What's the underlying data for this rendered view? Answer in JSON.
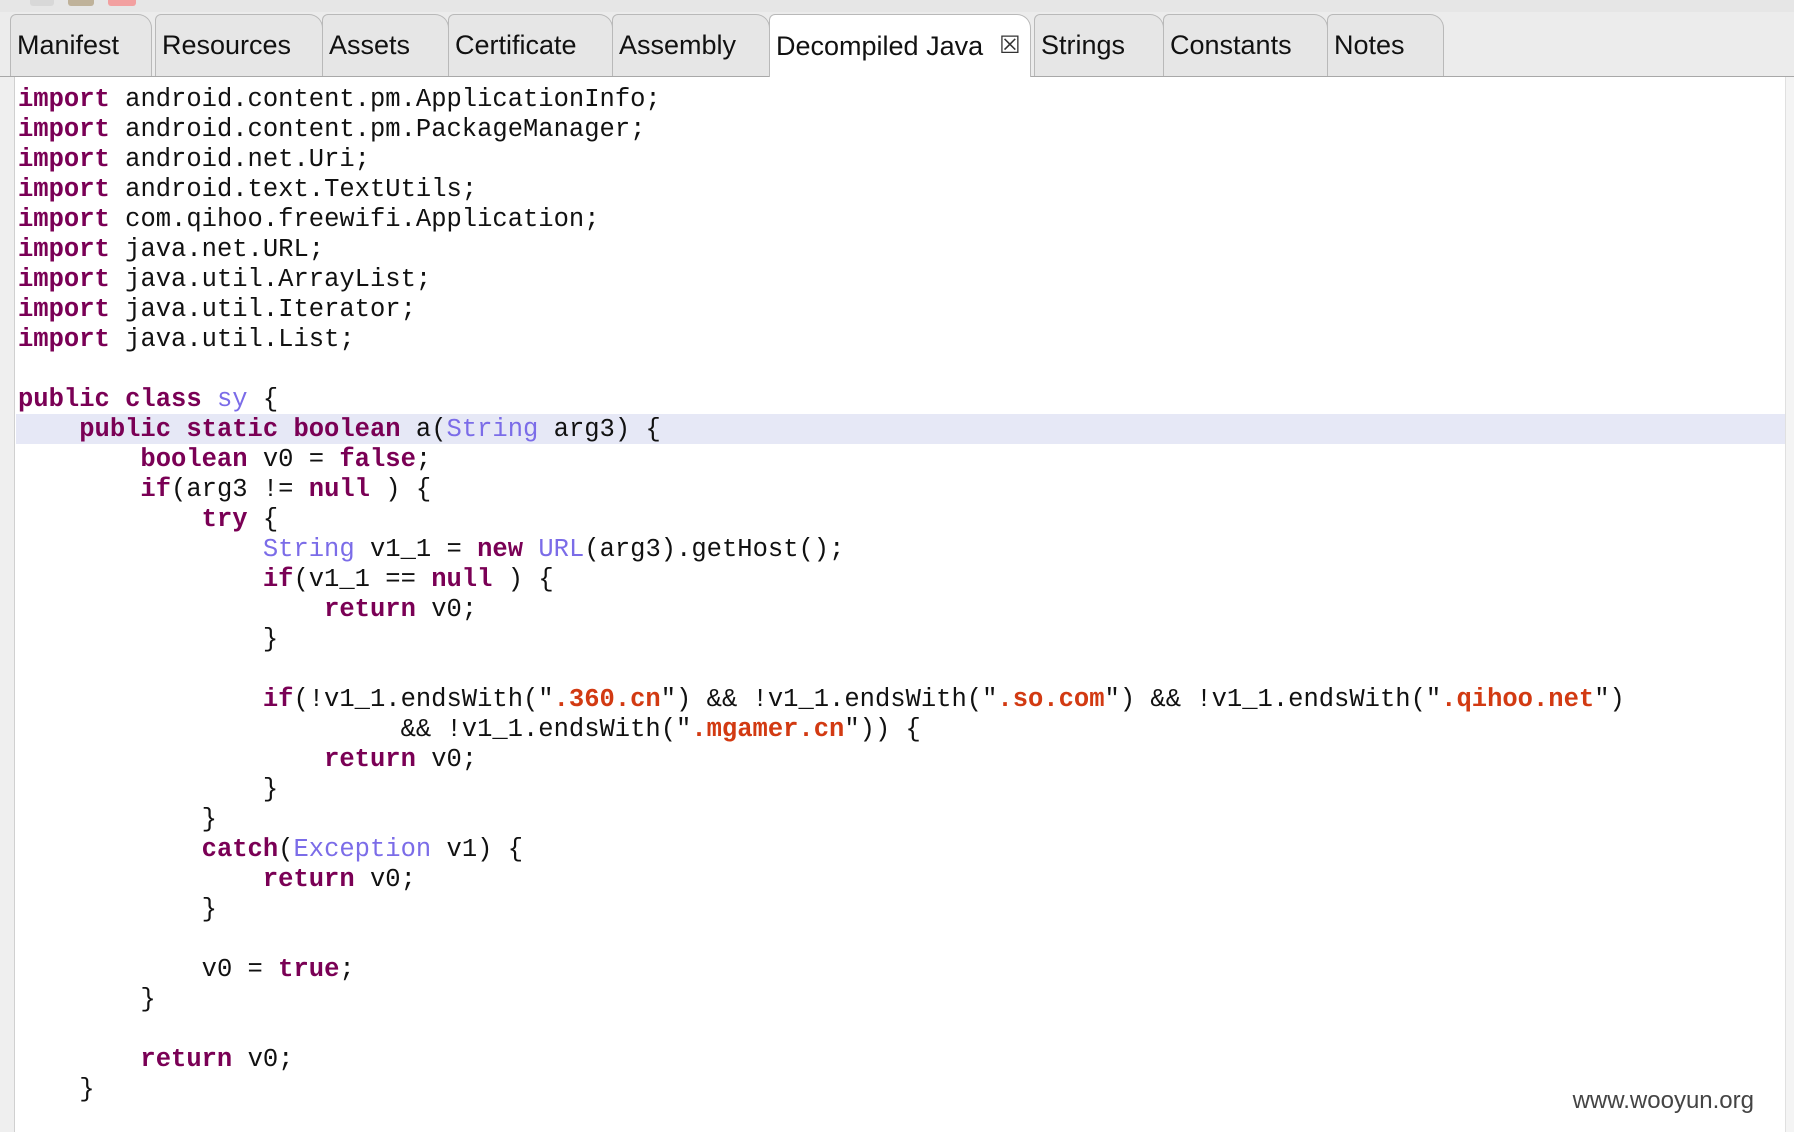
{
  "tabs": [
    {
      "label": "Manifest"
    },
    {
      "label": "Resources"
    },
    {
      "label": "Assets"
    },
    {
      "label": "Certificate"
    },
    {
      "label": "Assembly"
    },
    {
      "label": "Decompiled Java",
      "active": true,
      "close_glyph": "☒"
    },
    {
      "label": "Strings"
    },
    {
      "label": "Constants"
    },
    {
      "label": "Notes"
    }
  ],
  "editor": {
    "language": "java",
    "lines": [
      {
        "indent": "",
        "t": [
          [
            "kw",
            "import"
          ],
          [
            "",
            "android.content.pm.ApplicationInfo;"
          ]
        ]
      },
      {
        "indent": "",
        "t": [
          [
            "kw",
            "import"
          ],
          [
            "",
            "android.content.pm.PackageManager;"
          ]
        ]
      },
      {
        "indent": "",
        "t": [
          [
            "kw",
            "import"
          ],
          [
            "",
            "android.net.Uri;"
          ]
        ]
      },
      {
        "indent": "",
        "t": [
          [
            "kw",
            "import"
          ],
          [
            "",
            "android.text.TextUtils;"
          ]
        ]
      },
      {
        "indent": "",
        "t": [
          [
            "kw",
            "import"
          ],
          [
            "",
            "com.qihoo.freewifi.Application;"
          ]
        ]
      },
      {
        "indent": "",
        "t": [
          [
            "kw",
            "import"
          ],
          [
            "",
            "java.net.URL;"
          ]
        ]
      },
      {
        "indent": "",
        "t": [
          [
            "kw",
            "import"
          ],
          [
            "",
            "java.util.ArrayList;"
          ]
        ]
      },
      {
        "indent": "",
        "t": [
          [
            "kw",
            "import"
          ],
          [
            "",
            "java.util.Iterator;"
          ]
        ]
      },
      {
        "indent": "",
        "t": [
          [
            "kw",
            "import"
          ],
          [
            "",
            "java.util.List;"
          ]
        ]
      },
      {
        "indent": "",
        "t": []
      },
      {
        "indent": "",
        "t": [
          [
            "kw",
            "public class"
          ],
          [
            "ty",
            "sy"
          ],
          [
            "",
            "{"
          ]
        ]
      },
      {
        "indent": "    ",
        "highlight": true,
        "t": [
          [
            "kw",
            "public static boolean"
          ],
          [
            "",
            "a("
          ],
          [
            "ty",
            "String"
          ],
          [
            "",
            "arg3) {"
          ]
        ]
      },
      {
        "indent": "        ",
        "t": [
          [
            "kw",
            "boolean"
          ],
          [
            "",
            "v0 = "
          ],
          [
            "kw",
            "false"
          ],
          [
            "",
            ";"
          ]
        ]
      },
      {
        "indent": "        ",
        "t": [
          [
            "kw",
            "if"
          ],
          [
            "",
            "(arg3 != "
          ],
          [
            "kw",
            "null"
          ],
          [
            "",
            ") {"
          ]
        ]
      },
      {
        "indent": "            ",
        "t": [
          [
            "kw",
            "try"
          ],
          [
            "",
            "{"
          ]
        ]
      },
      {
        "indent": "                ",
        "t": [
          [
            "ty",
            "String"
          ],
          [
            "",
            "v1_1 = "
          ],
          [
            "kw",
            "new"
          ],
          [
            "ty",
            "URL"
          ],
          [
            "",
            "(arg3).getHost();"
          ]
        ]
      },
      {
        "indent": "                ",
        "t": [
          [
            "kw",
            "if"
          ],
          [
            "",
            "(v1_1 == "
          ],
          [
            "kw",
            "null"
          ],
          [
            "",
            ") {"
          ]
        ]
      },
      {
        "indent": "                    ",
        "t": [
          [
            "kw",
            "return"
          ],
          [
            "",
            "v0;"
          ]
        ]
      },
      {
        "indent": "                ",
        "t": [
          [
            "",
            "}"
          ]
        ]
      },
      {
        "indent": "",
        "t": []
      },
      {
        "indent": "                ",
        "t": [
          [
            "kw",
            "if"
          ],
          [
            "",
            "(!v1_1.endsWith(\""
          ],
          [
            "str",
            ".360.cn"
          ],
          [
            "",
            "\") && !v1_1.endsWith(\""
          ],
          [
            "str",
            ".so.com"
          ],
          [
            "",
            "\") && !v1_1.endsWith(\""
          ],
          [
            "str",
            ".qihoo.net"
          ],
          [
            "",
            "\")"
          ]
        ]
      },
      {
        "indent": "                         ",
        "t": [
          [
            "",
            "&& !v1_1.endsWith(\""
          ],
          [
            "str",
            ".mgamer.cn"
          ],
          [
            "",
            "\")) {"
          ]
        ]
      },
      {
        "indent": "                    ",
        "t": [
          [
            "kw",
            "return"
          ],
          [
            "",
            "v0;"
          ]
        ]
      },
      {
        "indent": "                ",
        "t": [
          [
            "",
            "}"
          ]
        ]
      },
      {
        "indent": "            ",
        "t": [
          [
            "",
            "}"
          ]
        ]
      },
      {
        "indent": "            ",
        "t": [
          [
            "kw",
            "catch"
          ],
          [
            "",
            "("
          ],
          [
            "ty",
            "Exception"
          ],
          [
            "",
            "v1) {"
          ]
        ]
      },
      {
        "indent": "                ",
        "t": [
          [
            "kw",
            "return"
          ],
          [
            "",
            "v0;"
          ]
        ]
      },
      {
        "indent": "            ",
        "t": [
          [
            "",
            "}"
          ]
        ]
      },
      {
        "indent": "",
        "t": []
      },
      {
        "indent": "            ",
        "t": [
          [
            "",
            "v0 = "
          ],
          [
            "kw",
            "true"
          ],
          [
            "",
            ";"
          ]
        ]
      },
      {
        "indent": "        ",
        "t": [
          [
            "",
            "}"
          ]
        ]
      },
      {
        "indent": "",
        "t": []
      },
      {
        "indent": "        ",
        "t": [
          [
            "kw",
            "return"
          ],
          [
            "",
            "v0;"
          ]
        ]
      },
      {
        "indent": "    ",
        "t": [
          [
            "",
            "}"
          ]
        ]
      }
    ]
  },
  "watermark": "www.wooyun.org",
  "colors": {
    "keyword": "#7a0055",
    "type": "#7b6ce8",
    "string": "#d23a12",
    "highlight_line": "#e6e8f6",
    "tab_bg": "#e6e6e6",
    "active_tab_bg": "#ffffff"
  }
}
